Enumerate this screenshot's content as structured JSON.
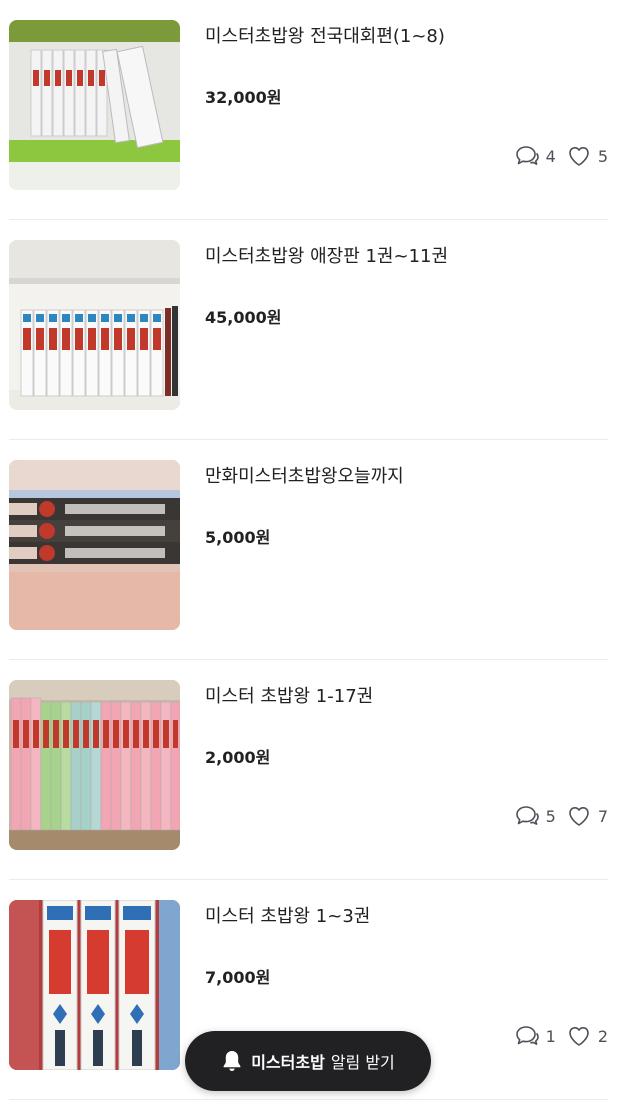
{
  "items": [
    {
      "title": "미스터초밥왕 전국대회편(1~8)",
      "price": "32,000원",
      "comments": "4",
      "likes": "5",
      "image": "manga-boxset-on-green-shelf"
    },
    {
      "title": "미스터초밥왕 애장판 1권~11권",
      "price": "45,000원",
      "comments": null,
      "likes": null,
      "image": "manga-volumes-on-white-shelf"
    },
    {
      "title": "만화미스터초밥왕오늘까지",
      "price": "5,000원",
      "comments": null,
      "likes": null,
      "image": "manga-stacked-spines"
    },
    {
      "title": "미스터 초밥왕 1-17권",
      "price": "2,000원",
      "comments": "5",
      "likes": "7",
      "image": "manga-colorful-spines"
    },
    {
      "title": "미스터 초밥왕 1~3권",
      "price": "7,000원",
      "comments": "1",
      "likes": "2",
      "image": "manga-three-volumes"
    }
  ],
  "alarm": {
    "keyword": "미스터초밥",
    "label": "알림 받기",
    "icon": "bell-icon"
  },
  "colors": {
    "text": "#212124",
    "muted": "#4d5159",
    "divider": "#e9ecef",
    "pill": "#212124"
  }
}
